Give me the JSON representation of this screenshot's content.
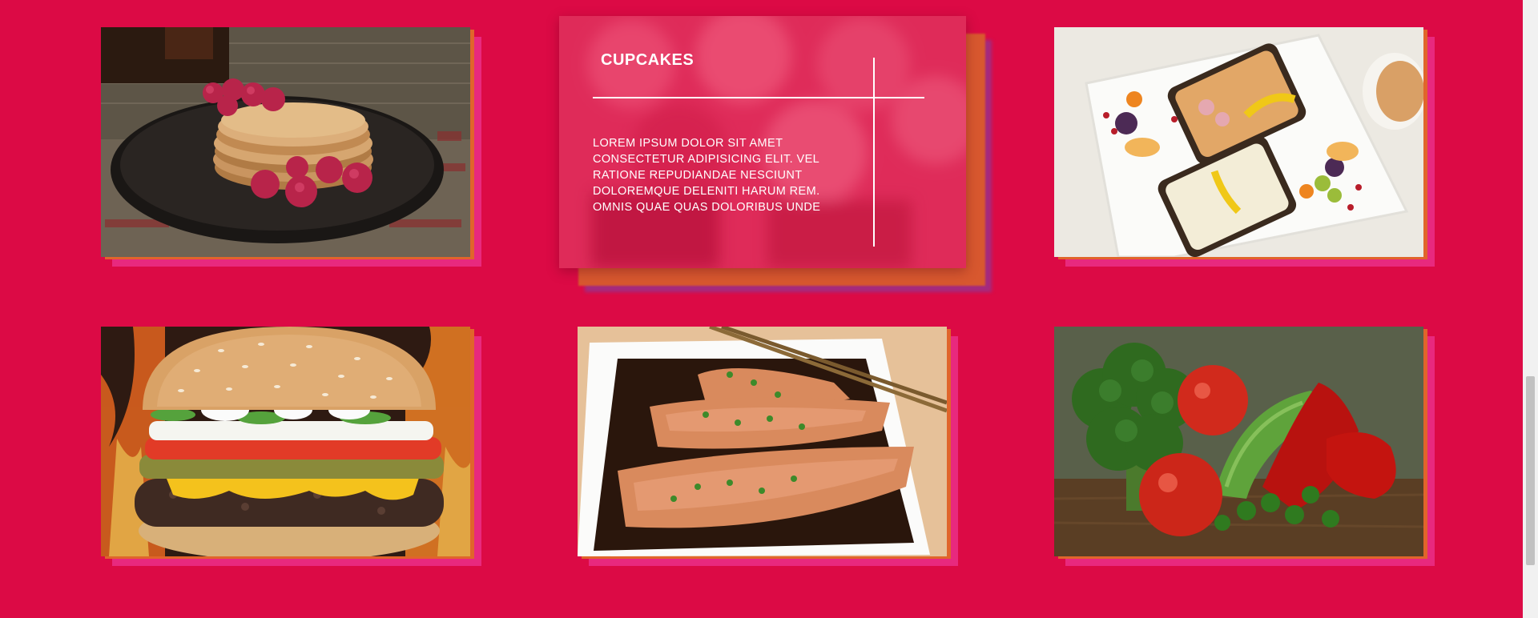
{
  "gallery": {
    "items": [
      {
        "name": "pancakes",
        "alt": "Pancakes with raspberries and syrup"
      },
      {
        "name": "cupcakes",
        "title": "CUPCAKES",
        "description": "LOREM IPSUM DOLOR SIT AMET CONSECTETUR ADIPISICING ELIT. VEL RATIONE REPUDIANDAE NESCIUNT DOLOREMQUE DELENITI HARUM REM. OMNIS QUAE QUAS DOLORIBUS UNDE",
        "state": "hovered"
      },
      {
        "name": "open-sandwiches",
        "alt": "Open sandwiches with fruit and coffee"
      },
      {
        "name": "cheeseburger",
        "alt": "Cheeseburger in front of flames"
      },
      {
        "name": "salmon",
        "alt": "Grilled salmon with chopsticks"
      },
      {
        "name": "vegetables",
        "alt": "Broccoli, tomatoes, cucumber and peppers"
      }
    ]
  },
  "colors": {
    "background": "#dc0a45",
    "shadow_pink": "#e8297e",
    "shadow_orange": "#e0652b",
    "overlay": "#e20c46"
  }
}
